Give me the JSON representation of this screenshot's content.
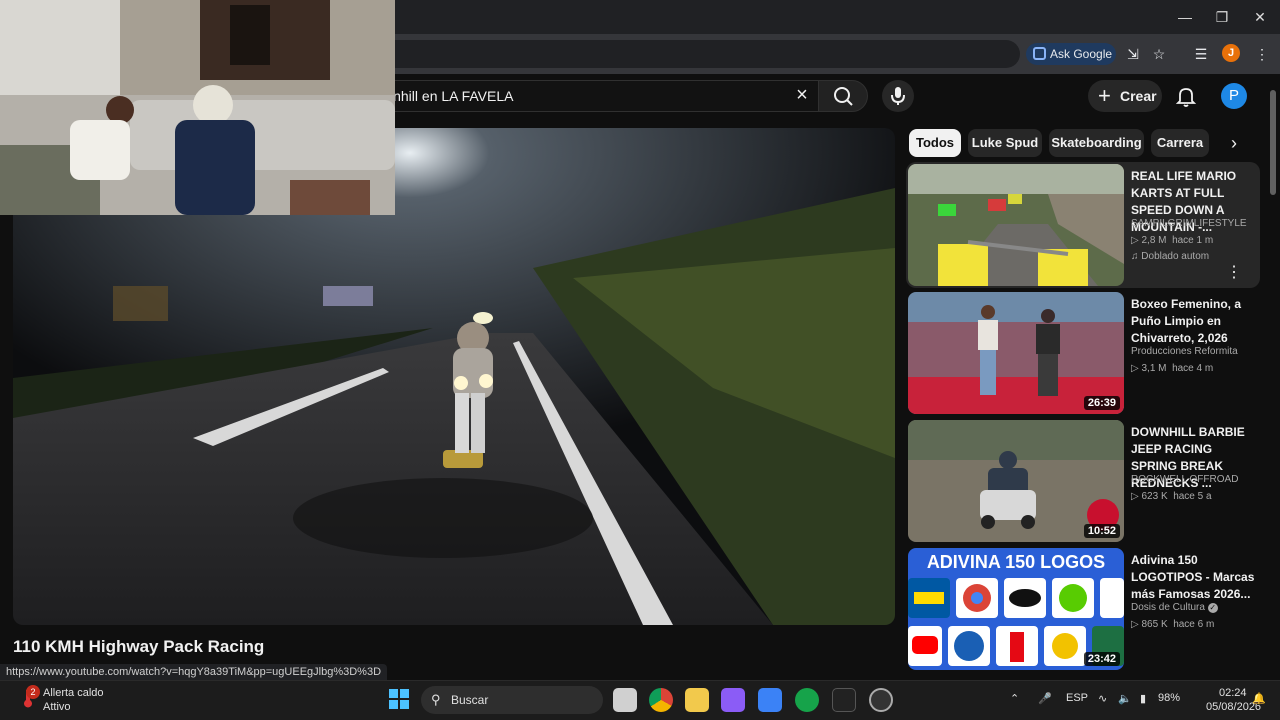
{
  "browser": {
    "ask_google_label": "Ask Google",
    "profile_initial": "J"
  },
  "youtube": {
    "search_value": "wnhill en LA FAVELA",
    "create_label": "Crear",
    "avatar_initial": "P"
  },
  "video": {
    "title": "110 KMH Highway Pack Racing"
  },
  "chips": [
    {
      "label": "Todos",
      "active": true
    },
    {
      "label": "Luke Spud"
    },
    {
      "label": "Skateboarding"
    },
    {
      "label": "Carrera"
    }
  ],
  "recommendations": [
    {
      "title": "REAL LIFE MARIO KARTS AT FULL SPEED DOWN A MOUNTAIN -...",
      "channel": "SAMPILGRIMLIFESTYLE",
      "views": "2,8 M",
      "age": "hace 1 m",
      "dub_label": "Doblado autom",
      "duration": ""
    },
    {
      "title": "Boxeo Femenino, a Puño Limpio en Chivarreto, 2,026",
      "channel": "Producciones Reformita",
      "views": "3,1 M",
      "age": "hace 4 m",
      "duration": "26:39"
    },
    {
      "title": "DOWNHILL BARBIE JEEP RACING SPRING BREAK REDNECKS ...",
      "channel": "ROCKWELL OFFROAD",
      "views": "623 K",
      "age": "hace 5 a",
      "duration": "10:52"
    },
    {
      "title": "Adivina 150 LOGOTIPOS - Marcas más Famosas 2026...",
      "channel": "Dosis de Cultura",
      "views": "865 K",
      "age": "hace 6 m",
      "duration": "23:42",
      "thumb_text": "ADIVINA 150 LOGOS"
    }
  ],
  "status_url": "https://www.youtube.com/watch?v=hqgY8a39TiM&pp=ugUEEgJlbg%3D%3D",
  "taskbar": {
    "weather_badge": "2",
    "weather_title": "Allerta caldo",
    "weather_sub": "Attivo",
    "search_placeholder": "Buscar",
    "lang": "ESP",
    "battery": "98%",
    "time": "02:24",
    "date": "05/08/2026"
  },
  "colors": {
    "background": "#0f0f0f",
    "chip_active": "#f1f1f1",
    "avatar": "#1e88e5",
    "taskbar": "#1c1c1c"
  }
}
